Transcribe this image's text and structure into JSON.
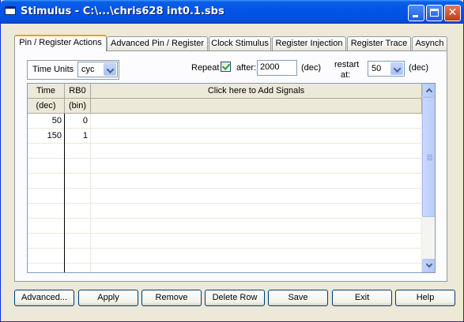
{
  "window": {
    "title": "Stimulus - C:\\...\\chris628 int0.1.sbs"
  },
  "tabs": [
    {
      "label": "Pin / Register Actions"
    },
    {
      "label": "Advanced Pin / Register"
    },
    {
      "label": "Clock Stimulus"
    },
    {
      "label": "Register Injection"
    },
    {
      "label": "Register Trace"
    },
    {
      "label": "Asynch"
    }
  ],
  "controls": {
    "time_units_label": "Time Units",
    "time_units_value": "cyc",
    "repeat_label": "Repeat",
    "repeat_checked": true,
    "after_label": "after:",
    "after_value": "2000",
    "after_unit": "(dec)",
    "restart_label_1": "restart",
    "restart_label_2": "at:",
    "restart_value": "50",
    "restart_unit": "(dec)"
  },
  "grid": {
    "columns": [
      {
        "title": "Time",
        "subtitle": "(dec)"
      },
      {
        "title": "RB0",
        "subtitle": "(bin)"
      },
      {
        "title": "Click here to Add Signals",
        "subtitle": ""
      }
    ],
    "rows": [
      {
        "time": "50",
        "rb0": "0"
      },
      {
        "time": "150",
        "rb0": "1"
      }
    ]
  },
  "buttons": {
    "advanced": "Advanced...",
    "apply": "Apply",
    "remove": "Remove",
    "delete_row": "Delete Row",
    "save": "Save",
    "exit": "Exit",
    "help": "Help"
  },
  "colors": {
    "titlebar": "#0355e8",
    "active_tab_accent": "#ff9a1a",
    "window_bg": "#ece9d8",
    "checkbox_check": "#21a121"
  }
}
